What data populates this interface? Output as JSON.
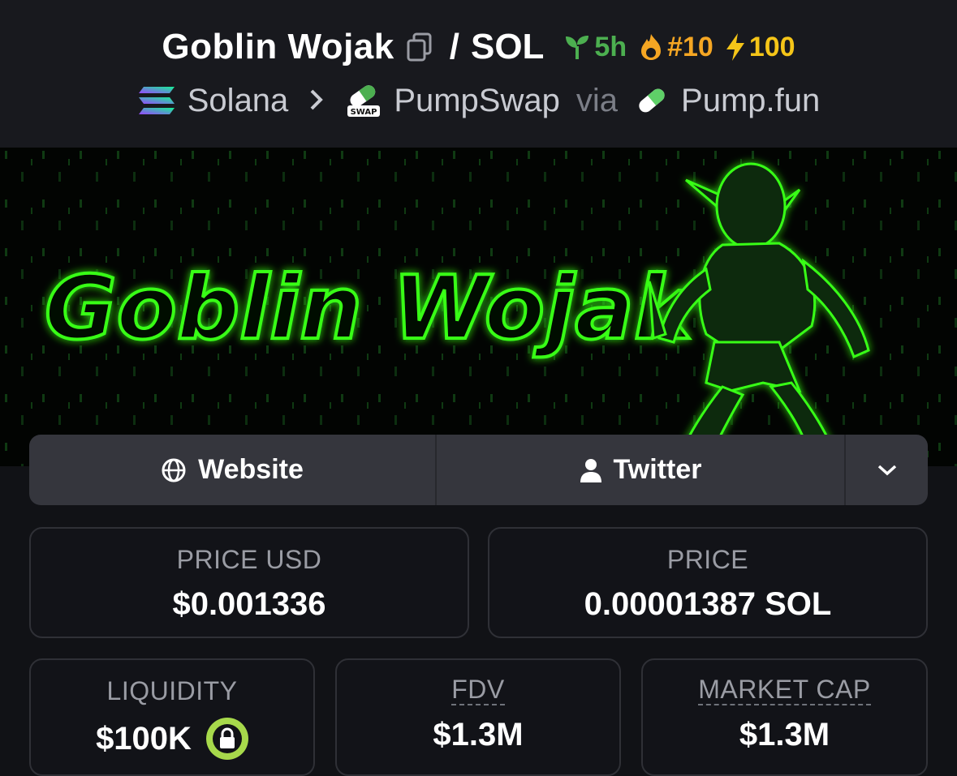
{
  "header": {
    "token_name": "Goblin Wojak",
    "separator": "/",
    "quote_symbol": "SOL",
    "age": "5h",
    "trending_rank": "#10",
    "boost": "100",
    "chain": "Solana",
    "dex": "PumpSwap",
    "via_label": "via",
    "launchpad": "Pump.fun",
    "dex_icon_text": "SWAP"
  },
  "banner": {
    "title_text": "Goblin Wojak",
    "glow_color": "#39ff14"
  },
  "links": {
    "website_label": "Website",
    "twitter_label": "Twitter"
  },
  "stats": {
    "price_usd_label": "PRICE USD",
    "price_usd_value": "$0.001336",
    "price_label": "PRICE",
    "price_value": "0.00001387 SOL",
    "liquidity_label": "LIQUIDITY",
    "liquidity_value": "$100K",
    "fdv_label": "FDV",
    "fdv_value": "$1.3M",
    "mcap_label": "MARKET CAP",
    "mcap_value": "$1.3M"
  },
  "colors": {
    "age_green": "#4caf50",
    "trend_orange": "#f5a623",
    "boost_yellow": "#f5c518",
    "lock_green": "#a7d94b"
  }
}
